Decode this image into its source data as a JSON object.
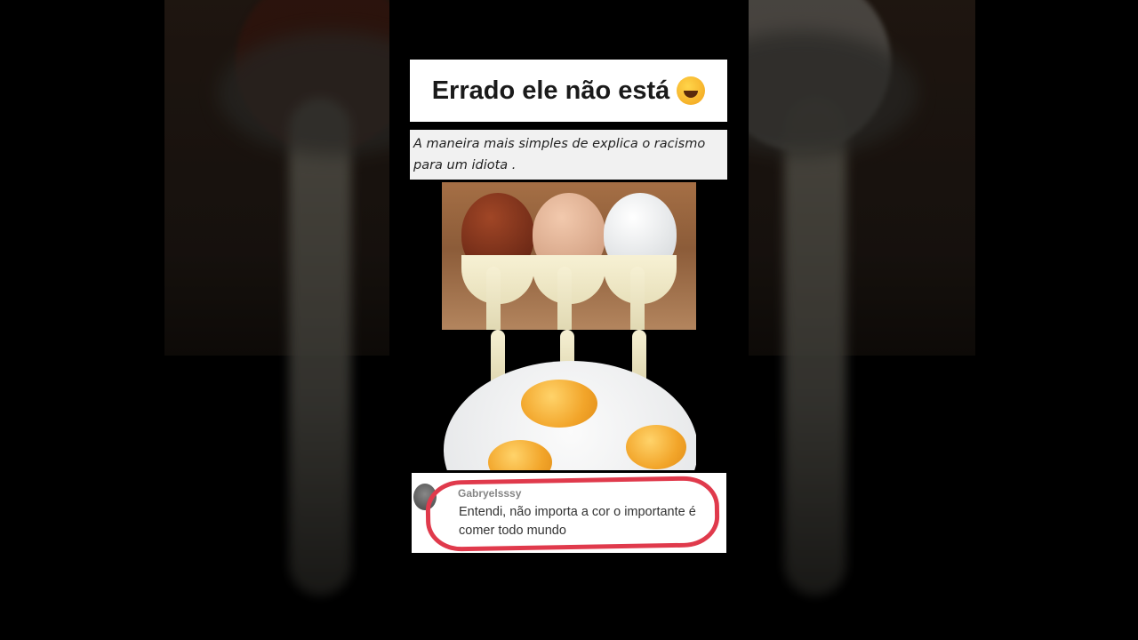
{
  "meme": {
    "title": "Errado ele não está",
    "title_emoji": "🤣",
    "caption": "A maneira mais simples de explica o racismo para um idiota .",
    "comment": {
      "username": "Gabryelsssy",
      "text": "Entendi, não importa a cor o importante é comer todo mundo"
    }
  },
  "colors": {
    "background": "#000000",
    "highlight_circle": "#e03a4c"
  }
}
